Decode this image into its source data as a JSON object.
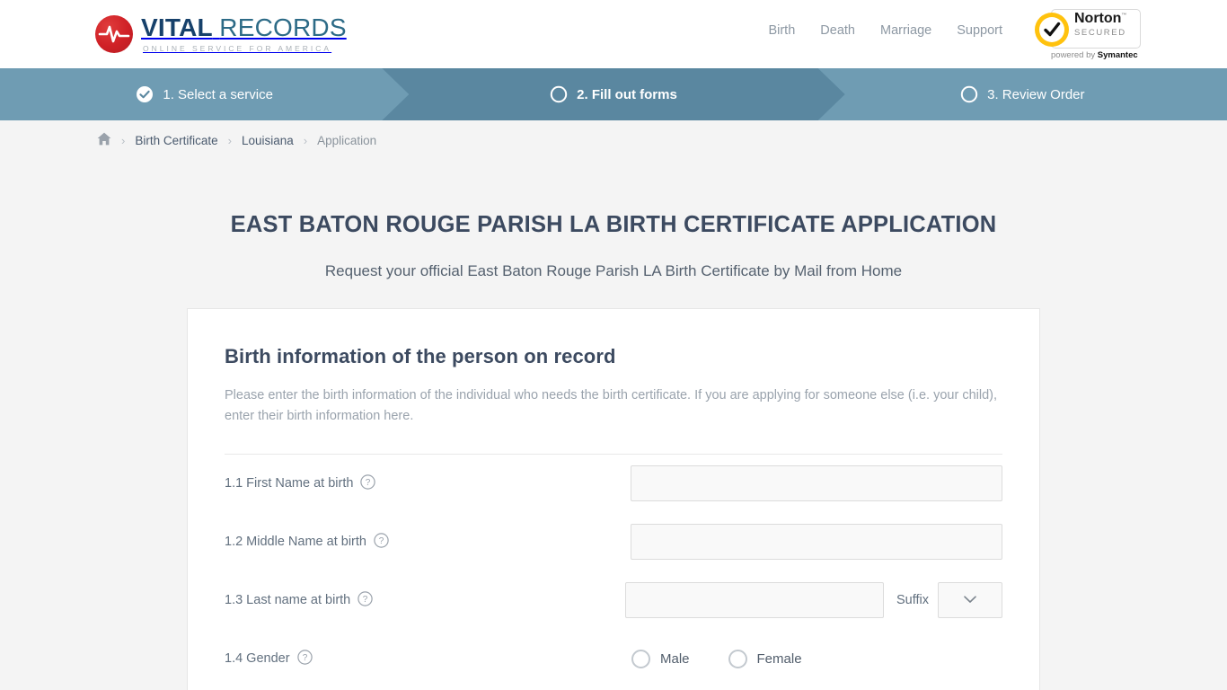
{
  "header": {
    "brand": {
      "word1": "VITAL",
      "word2": "RECORDS",
      "tagline": "ONLINE SERVICE FOR AMERICA",
      "icon": "heartbeat-pulse-icon"
    },
    "nav": [
      {
        "label": "Birth"
      },
      {
        "label": "Death"
      },
      {
        "label": "Marriage"
      },
      {
        "label": "Support"
      }
    ],
    "norton": {
      "name": "Norton",
      "secured": "SECURED",
      "trademark": "™",
      "powered_prefix": "powered by ",
      "powered_brand": "Symantec",
      "check_icon": "checkmark-icon",
      "badge_color": "#ffc20e"
    }
  },
  "stepper": {
    "steps": [
      {
        "label": "1. Select a service",
        "state": "completed",
        "icon": "check-circle-filled-icon"
      },
      {
        "label": "2. Fill out forms",
        "state": "active",
        "icon": "circle-outline-icon"
      },
      {
        "label": "3. Review Order",
        "state": "upcoming",
        "icon": "circle-outline-icon"
      }
    ],
    "bg_color": "#6f9cb3",
    "active_color": "#5a87a0"
  },
  "breadcrumb": {
    "home_icon": "home-icon",
    "separator": "›",
    "items": [
      {
        "label": "Birth Certificate",
        "type": "link"
      },
      {
        "label": "Louisiana",
        "type": "link"
      },
      {
        "label": "Application",
        "type": "current"
      }
    ]
  },
  "page": {
    "title": "EAST BATON ROUGE PARISH LA BIRTH CERTIFICATE APPLICATION",
    "subtitle": "Request your official East Baton Rouge Parish LA Birth Certificate by Mail from Home",
    "title_color": "#3c4a60"
  },
  "form": {
    "heading": "Birth information of the person on record",
    "intro": "Please enter the birth information of the individual who needs the birth certificate. If you are applying for someone else (i.e. your child), enter their birth information here.",
    "fields": {
      "first_name": {
        "label": "1.1 First Name at birth",
        "help_icon": "question-circle-icon",
        "value": "",
        "placeholder": ""
      },
      "middle_name": {
        "label": "1.2 Middle Name at birth",
        "help_icon": "question-circle-icon",
        "value": "",
        "placeholder": ""
      },
      "last_name": {
        "label": "1.3 Last name at birth",
        "help_icon": "question-circle-icon",
        "value": "",
        "placeholder": "",
        "suffix_label": "Suffix",
        "suffix_value": "",
        "suffix_icon": "chevron-down-icon"
      },
      "gender": {
        "label": "1.4 Gender",
        "help_icon": "question-circle-icon",
        "options": [
          {
            "label": "Male",
            "selected": false
          },
          {
            "label": "Female",
            "selected": false
          }
        ]
      }
    }
  }
}
